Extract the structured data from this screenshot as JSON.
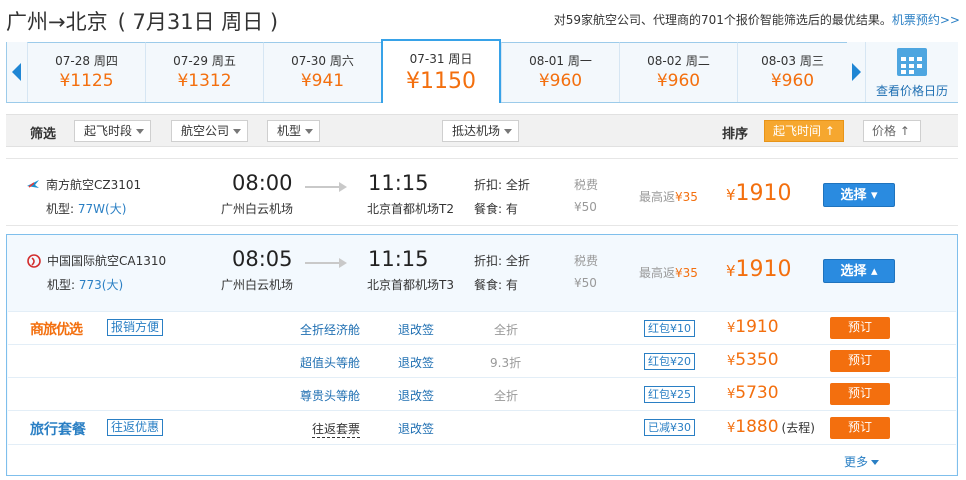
{
  "header": {
    "route": "广州→北京",
    "date": "( 7月31日 周日 )",
    "summary_pre": "对59家航空公司、代理商的701个报价智能筛选后的最优结果。",
    "summary_link": "机票预约>>"
  },
  "dates": [
    {
      "label": "07-28 周四",
      "price": "¥1125"
    },
    {
      "label": "07-29 周五",
      "price": "¥1312"
    },
    {
      "label": "07-30 周六",
      "price": "¥941"
    },
    {
      "label": "07-31 周日",
      "price": "¥1150",
      "selected": true
    },
    {
      "label": "08-01 周一",
      "price": "¥960"
    },
    {
      "label": "08-02 周二",
      "price": "¥960"
    },
    {
      "label": "08-03 周三",
      "price": "¥960"
    }
  ],
  "calendar_label": "查看价格日历",
  "filters": {
    "label": "筛选",
    "items": [
      "起飞时段",
      "航空公司",
      "机型",
      "抵达机场"
    ],
    "sort_label": "排序",
    "sort_items": [
      "起飞时间 ↑",
      "价格 ↑"
    ]
  },
  "flights": [
    {
      "airline": "南方航空CZ3101",
      "model_label": "机型:",
      "model": "77W(大)",
      "dep_time": "08:00",
      "dep_airport": "广州白云机场",
      "arr_time": "11:15",
      "arr_airport": "北京首都机场T2",
      "discount": "折扣: 全折",
      "meal": "餐食: 有",
      "tax_label": "税费",
      "tax": "¥50",
      "rebate_label": "最高返",
      "rebate": "¥35",
      "price": "1910",
      "currency": "¥",
      "select_label": "选择 ▾"
    },
    {
      "airline": "中国国际航空CA1310",
      "model_label": "机型:",
      "model": "773(大)",
      "dep_time": "08:05",
      "dep_airport": "广州白云机场",
      "arr_time": "11:15",
      "arr_airport": "北京首都机场T3",
      "discount": "折扣: 全折",
      "meal": "餐食: 有",
      "tax_label": "税费",
      "tax": "¥50",
      "rebate_label": "最高返",
      "rebate": "¥35",
      "price": "1910",
      "currency": "¥",
      "select_label": "选择 ▴"
    }
  ],
  "offers": {
    "brand1": "商旅优选",
    "brand1_tag": "报销方便",
    "rows": [
      {
        "cabin": "全折经济舱",
        "change": "退改签",
        "discount": "全折",
        "tag": "红包¥10",
        "price": "1910",
        "book": "预订"
      },
      {
        "cabin": "超值头等舱",
        "change": "退改签",
        "discount": "9.3折",
        "tag": "红包¥20",
        "price": "5350",
        "book": "预订"
      },
      {
        "cabin": "尊贵头等舱",
        "change": "退改签",
        "discount": "全折",
        "tag": "红包¥25",
        "price": "5730",
        "book": "预订"
      }
    ],
    "brand2": "旅行套餐",
    "brand2_tag": "往返优惠",
    "package": {
      "name": "往返套票",
      "change": "退改签",
      "tag": "已减¥30",
      "price": "1880",
      "note": "(去程)",
      "book": "预订"
    },
    "currency": "¥",
    "more": "更多"
  },
  "colors": {
    "accent_blue": "#2a8be0",
    "accent_orange": "#f36f0e",
    "selected_border": "#37a2e8"
  }
}
